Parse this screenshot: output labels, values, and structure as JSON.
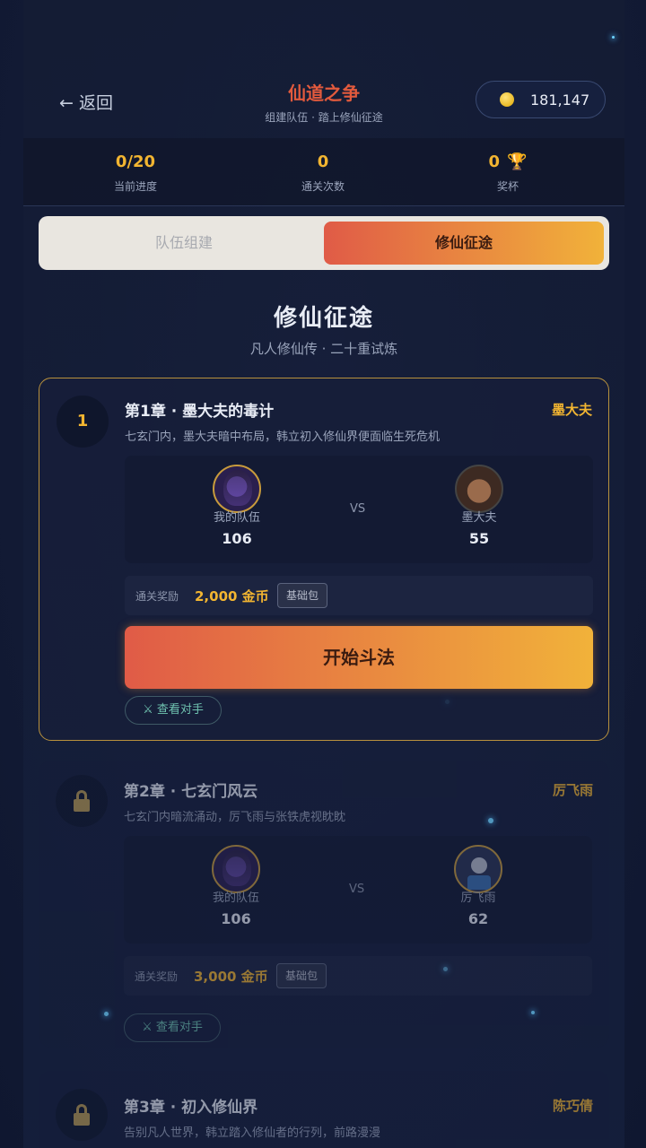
{
  "header": {
    "back_label": "← 返回",
    "title": "仙道之争",
    "subtitle": "组建队伍 · 踏上修仙征途",
    "coins": "181,147"
  },
  "stats": [
    {
      "value": "0/20",
      "label": "当前进度"
    },
    {
      "value": "0",
      "label": "通关次数"
    },
    {
      "value": "0",
      "label": "奖杯"
    }
  ],
  "tabs": {
    "team": "队伍组建",
    "journey": "修仙征途"
  },
  "section": {
    "title": "修仙征途",
    "subtitle": "凡人修仙传 · 二十重试炼"
  },
  "chapters": [
    {
      "number": "1",
      "title": "第1章 · 墨大夫的毒计",
      "boss": "墨大夫",
      "desc": "七玄门内，墨大夫暗中布局，韩立初入修仙界便面临生死危机",
      "my_label": "我的队伍",
      "my_power": "106",
      "vs": "VS",
      "enemy_label": "墨大夫",
      "enemy_power": "55",
      "reward_label": "通关奖励",
      "reward_value": "2,000 金币",
      "reward_badge": "基础包",
      "fight_label": "开始斗法",
      "view_label": "⚔ 查看对手"
    },
    {
      "title": "第2章 · 七玄门风云",
      "boss": "厉飞雨",
      "desc": "七玄门内暗流涌动，厉飞雨与张铁虎视眈眈",
      "my_label": "我的队伍",
      "my_power": "106",
      "vs": "VS",
      "enemy_label": "厉飞雨",
      "enemy_power": "62",
      "reward_label": "通关奖励",
      "reward_value": "3,000 金币",
      "reward_badge": "基础包",
      "view_label": "⚔ 查看对手"
    },
    {
      "title": "第3章 · 初入修仙界",
      "boss": "陈巧倩",
      "desc": "告别凡人世界，韩立踏入修仙者的行列，前路漫漫"
    }
  ]
}
